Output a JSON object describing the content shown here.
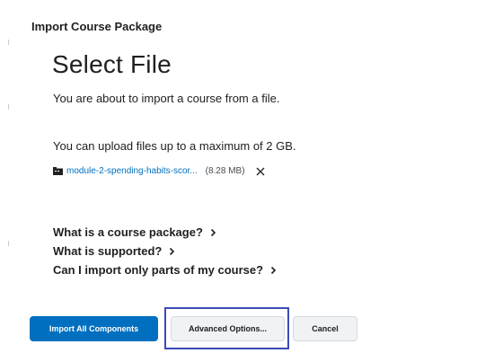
{
  "dialog": {
    "title": "Import Course Package"
  },
  "main": {
    "heading": "Select File",
    "intro": "You are about to import a course from a file.",
    "limit": "You can upload files up to a maximum of 2 GB."
  },
  "file": {
    "name": "module-2-spending-habits-scor...",
    "size": "(8.28 MB)",
    "icon": "folder-icon",
    "remove_icon": "close-icon",
    "link_color": "#006fbf"
  },
  "links": [
    {
      "label": "What is a course package?"
    },
    {
      "label": "What is supported?"
    },
    {
      "label": "Can I import only parts of my course?"
    }
  ],
  "buttons": {
    "import_all": "Import All Components",
    "advanced": "Advanced Options...",
    "cancel": "Cancel"
  },
  "colors": {
    "primary": "#006fbf",
    "focus_ring": "#3c4ab7",
    "secondary_bg": "#f1f2f4"
  }
}
